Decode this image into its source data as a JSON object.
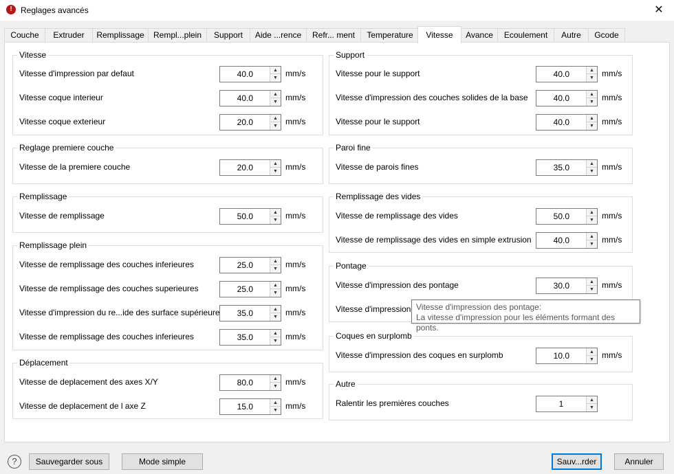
{
  "window": {
    "title": "Reglages avancés",
    "app_icon": "app-logo-icon",
    "close_icon": "close-icon"
  },
  "tabs": [
    {
      "label": "Couche"
    },
    {
      "label": "Extruder"
    },
    {
      "label": "Remplissage"
    },
    {
      "label": "Rempl...plein"
    },
    {
      "label": "Support"
    },
    {
      "label": "Aide ...rence"
    },
    {
      "label": "Refr... ment"
    },
    {
      "label": "Temperature"
    },
    {
      "label": "Vitesse",
      "active": true
    },
    {
      "label": "Avance"
    },
    {
      "label": "Ecoulement"
    },
    {
      "label": "Autre"
    },
    {
      "label": "Gcode"
    }
  ],
  "groups": {
    "vitesse": {
      "title": "Vitesse",
      "rows": [
        {
          "label": "Vitesse d'impression par defaut",
          "value": "40.0",
          "unit": "mm/s"
        },
        {
          "label": "Vitesse coque interieur",
          "value": "40.0",
          "unit": "mm/s"
        },
        {
          "label": "Vitesse coque exterieur",
          "value": "20.0",
          "unit": "mm/s"
        }
      ]
    },
    "premiere_couche": {
      "title": "Reglage premiere couche",
      "rows": [
        {
          "label": "Vitesse de la premiere couche",
          "value": "20.0",
          "unit": "mm/s"
        }
      ]
    },
    "remplissage": {
      "title": "Remplissage",
      "rows": [
        {
          "label": "Vitesse de remplissage",
          "value": "50.0",
          "unit": "mm/s"
        }
      ]
    },
    "remplissage_plein": {
      "title": "Remplissage plein",
      "rows": [
        {
          "label": "Vitesse de remplissage des couches inferieures",
          "value": "25.0",
          "unit": "mm/s"
        },
        {
          "label": "Vitesse de remplissage des couches superieures",
          "value": "25.0",
          "unit": "mm/s"
        },
        {
          "label": "Vitesse d'impression du re...ide des surface supérieure",
          "value": "35.0",
          "unit": "mm/s"
        },
        {
          "label": "Vitesse de remplissage des couches inferieures",
          "value": "35.0",
          "unit": "mm/s"
        }
      ]
    },
    "deplacement": {
      "title": "Déplacement",
      "rows": [
        {
          "label": "Vitesse de deplacement des axes X/Y",
          "value": "80.0",
          "unit": "mm/s"
        },
        {
          "label": "Vitesse de deplacement de l axe Z",
          "value": "15.0",
          "unit": "mm/s"
        }
      ]
    },
    "support": {
      "title": "Support",
      "rows": [
        {
          "label": "Vitesse pour le support",
          "value": "40.0",
          "unit": "mm/s"
        },
        {
          "label": "Vitesse d'impression des couches solides de la base",
          "value": "40.0",
          "unit": "mm/s"
        },
        {
          "label": "Vitesse pour le support",
          "value": "40.0",
          "unit": "mm/s"
        }
      ]
    },
    "paroi_fine": {
      "title": "Paroi fine",
      "rows": [
        {
          "label": "Vitesse de parois fines",
          "value": "35.0",
          "unit": "mm/s"
        }
      ]
    },
    "remplissage_vides": {
      "title": "Remplissage des vides",
      "rows": [
        {
          "label": "Vitesse de remplissage des vides",
          "value": "50.0",
          "unit": "mm/s"
        },
        {
          "label": "Vitesse de remplissage des vides en simple extrusion",
          "value": "40.0",
          "unit": "mm/s"
        }
      ]
    },
    "pontage": {
      "title": "Pontage",
      "rows": [
        {
          "label": "Vitesse d'impression des pontage",
          "value": "30.0",
          "unit": "mm/s"
        },
        {
          "label": "Vitesse d'impression de",
          "value": "",
          "unit": ""
        }
      ]
    },
    "coques_surplomb": {
      "title": "Coques en surplomb",
      "rows": [
        {
          "label": "Vitesse d'impression des coques en surplomb",
          "value": "10.0",
          "unit": "mm/s"
        }
      ]
    },
    "autre": {
      "title": "Autre",
      "rows": [
        {
          "label": "Ralentir les premières couches",
          "value": "1",
          "unit": ""
        }
      ]
    }
  },
  "tooltip": {
    "title": "Vitesse d'impression des pontage:",
    "text": "La vitesse d'impression pour les éléments formant des ponts."
  },
  "footer": {
    "help_icon": "?",
    "save_as": "Sauvegarder sous",
    "simple_mode": "Mode simple",
    "save": "Sauv...rder",
    "cancel": "Annuler"
  },
  "colors": {
    "default_button_border": "#0078d7",
    "app_icon": "#b3181b"
  }
}
